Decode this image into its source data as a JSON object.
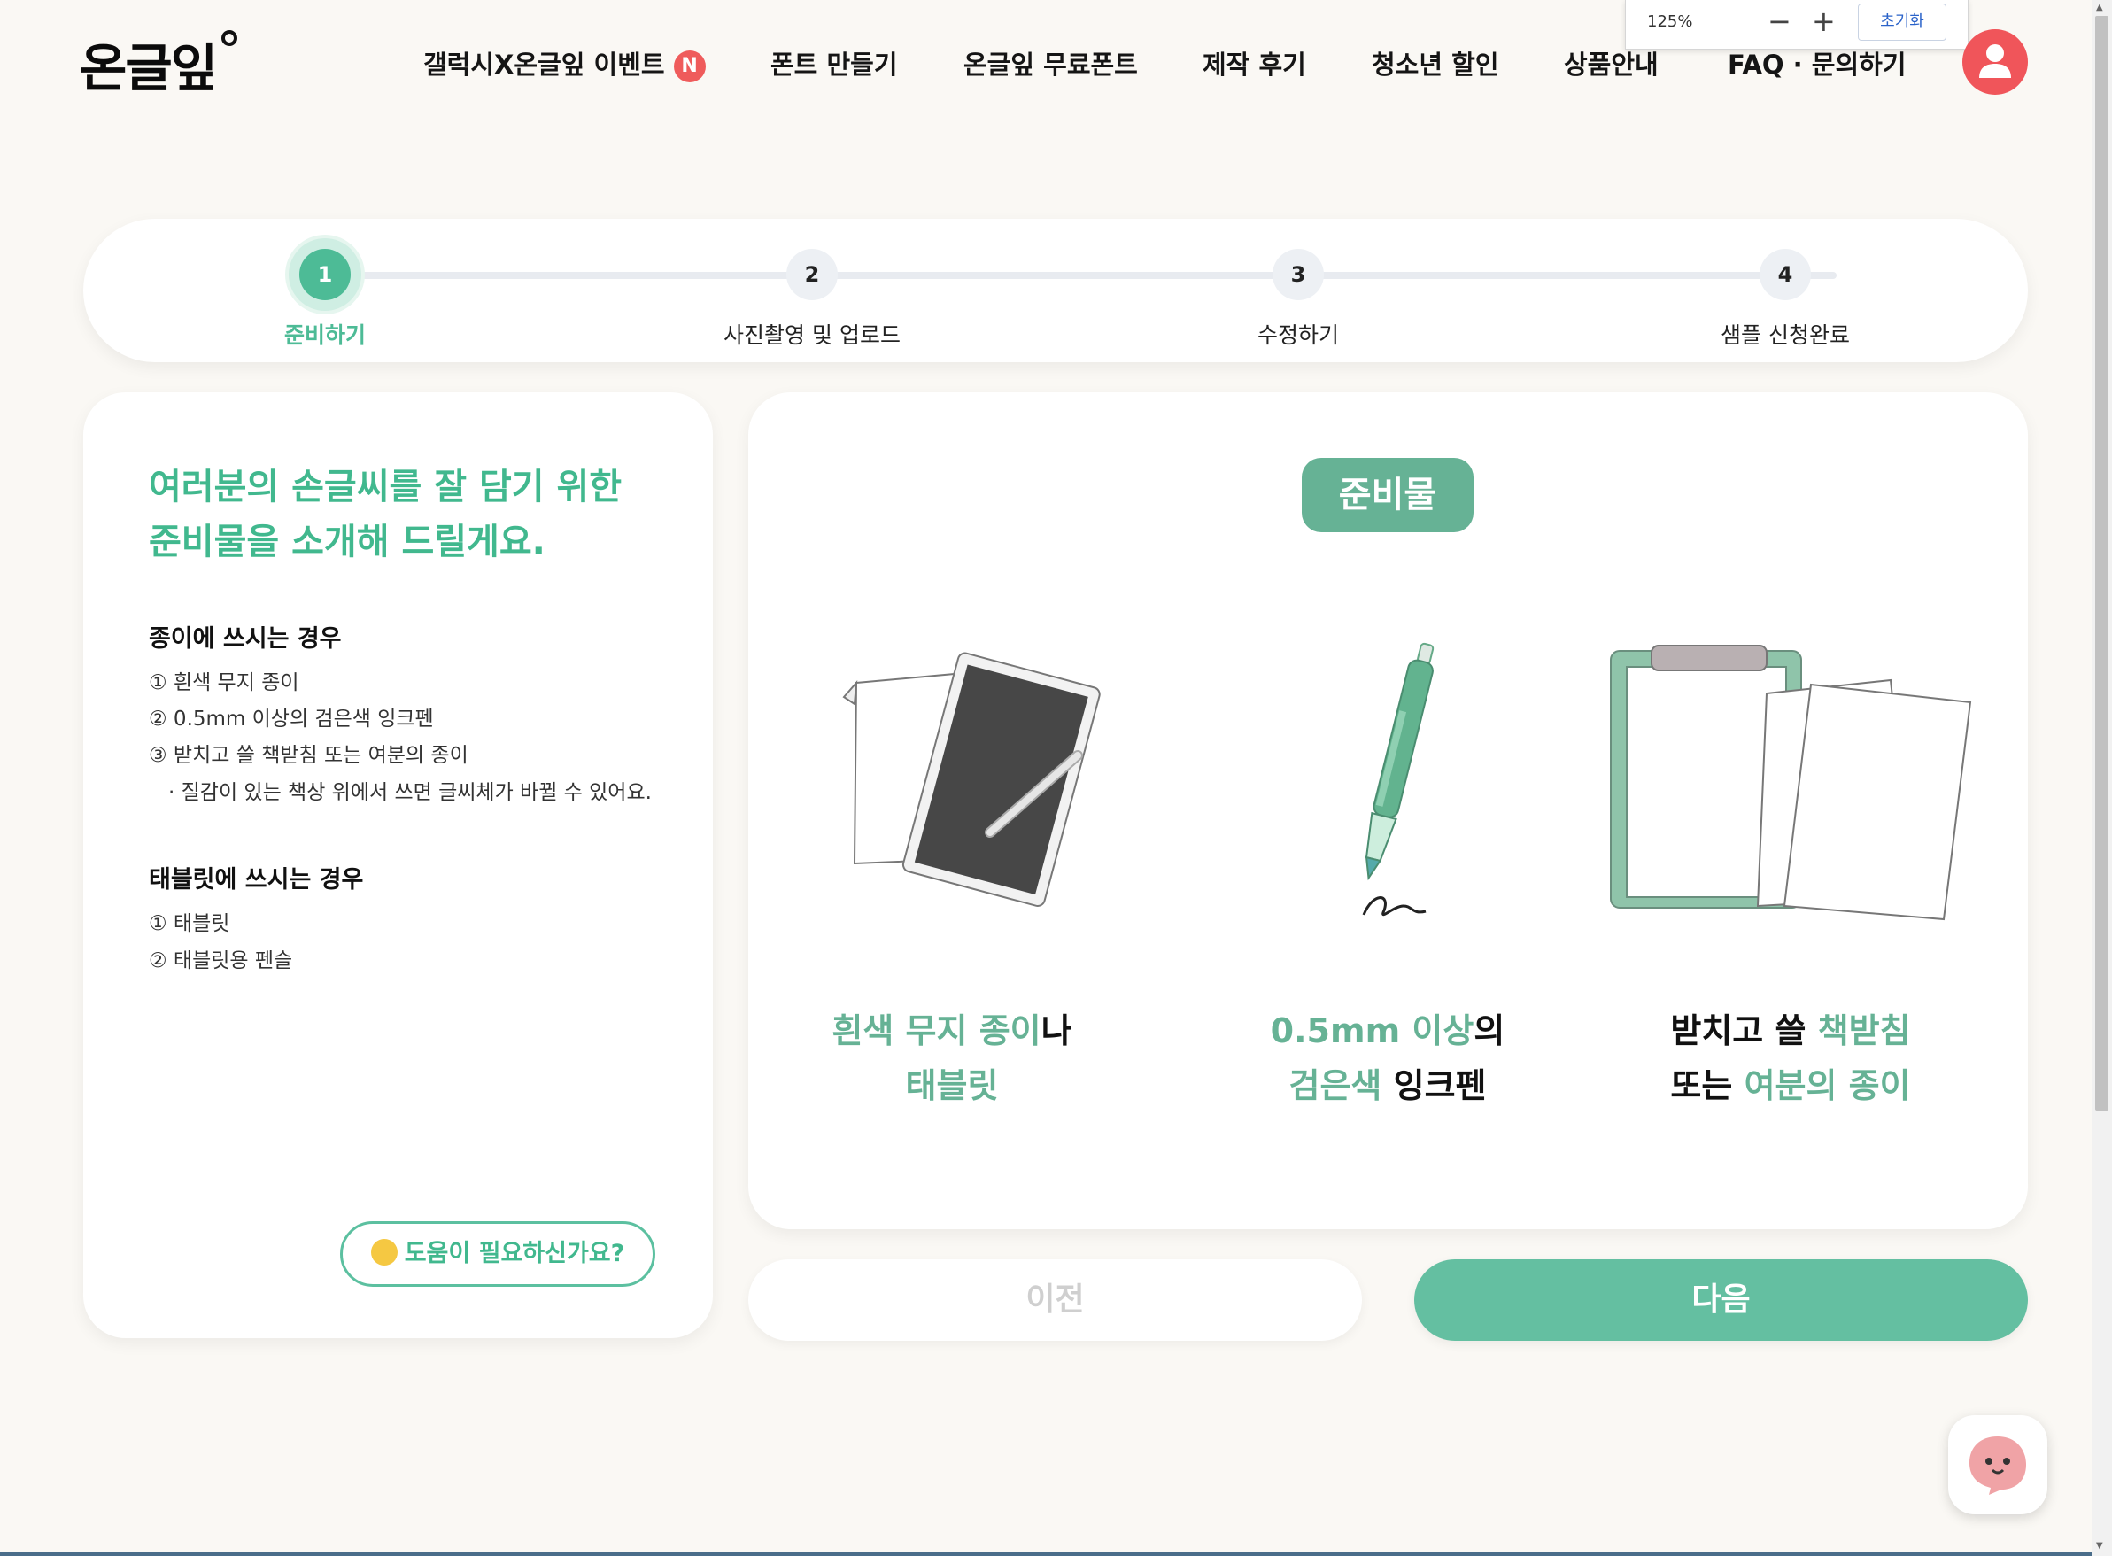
{
  "header": {
    "logo": "온글잎",
    "nav": [
      {
        "label": "갤럭시X온글잎 이벤트",
        "badge": "N"
      },
      {
        "label": "폰트 만들기"
      },
      {
        "label": "온글잎 무료폰트"
      },
      {
        "label": "제작 후기"
      },
      {
        "label": "청소년 할인"
      },
      {
        "label": "상품안내"
      },
      {
        "label": "FAQ · 문의하기"
      }
    ],
    "zoom": {
      "level": "125%",
      "minus": "−",
      "plus": "+",
      "reset": "초기화"
    }
  },
  "stepper": {
    "steps": [
      {
        "number": "1",
        "label": "준비하기",
        "active": true
      },
      {
        "number": "2",
        "label": "사진촬영 및 업로드"
      },
      {
        "number": "3",
        "label": "수정하기"
      },
      {
        "number": "4",
        "label": "샘플 신청완료"
      }
    ]
  },
  "left": {
    "intro_line1": "여러분의 손글씨를 잘 담기 위한",
    "intro_line2": "준비물을 소개해 드릴게요.",
    "paper": {
      "title": "종이에 쓰시는 경우",
      "items": [
        "① 흰색 무지 종이",
        "② 0.5mm 이상의 검은색 잉크펜",
        "③ 받치고 쓸 책받침 또는 여분의 종이",
        "· 질감이 있는 책상 위에서 쓰면 글씨체가 바뀔 수 있어요."
      ]
    },
    "tablet": {
      "title": "태블릿에 쓰시는 경우",
      "items": [
        "① 태블릿",
        "② 태블릿용 펜슬"
      ]
    },
    "help": "도움이 필요하신가요?"
  },
  "right": {
    "badge": "준비물",
    "captions": [
      {
        "l1a": "흰색 무지 종이",
        "l1b": "나",
        "l2a": "태블릿",
        "l2b": ""
      },
      {
        "l1a": "0.5mm 이상",
        "l1b": "의",
        "l2a": "검은색",
        "l2b": " 잉크펜"
      },
      {
        "l1a": "받치고 쓸 ",
        "l1b": "책받침",
        "l2a": "또는 ",
        "l2b": "여분의 종이"
      }
    ]
  },
  "buttons": {
    "prev": "이전",
    "next": "다음"
  },
  "colors": {
    "brand": "#4dbb96",
    "accent_red": "#f0555a",
    "badge_green": "#66b295"
  }
}
